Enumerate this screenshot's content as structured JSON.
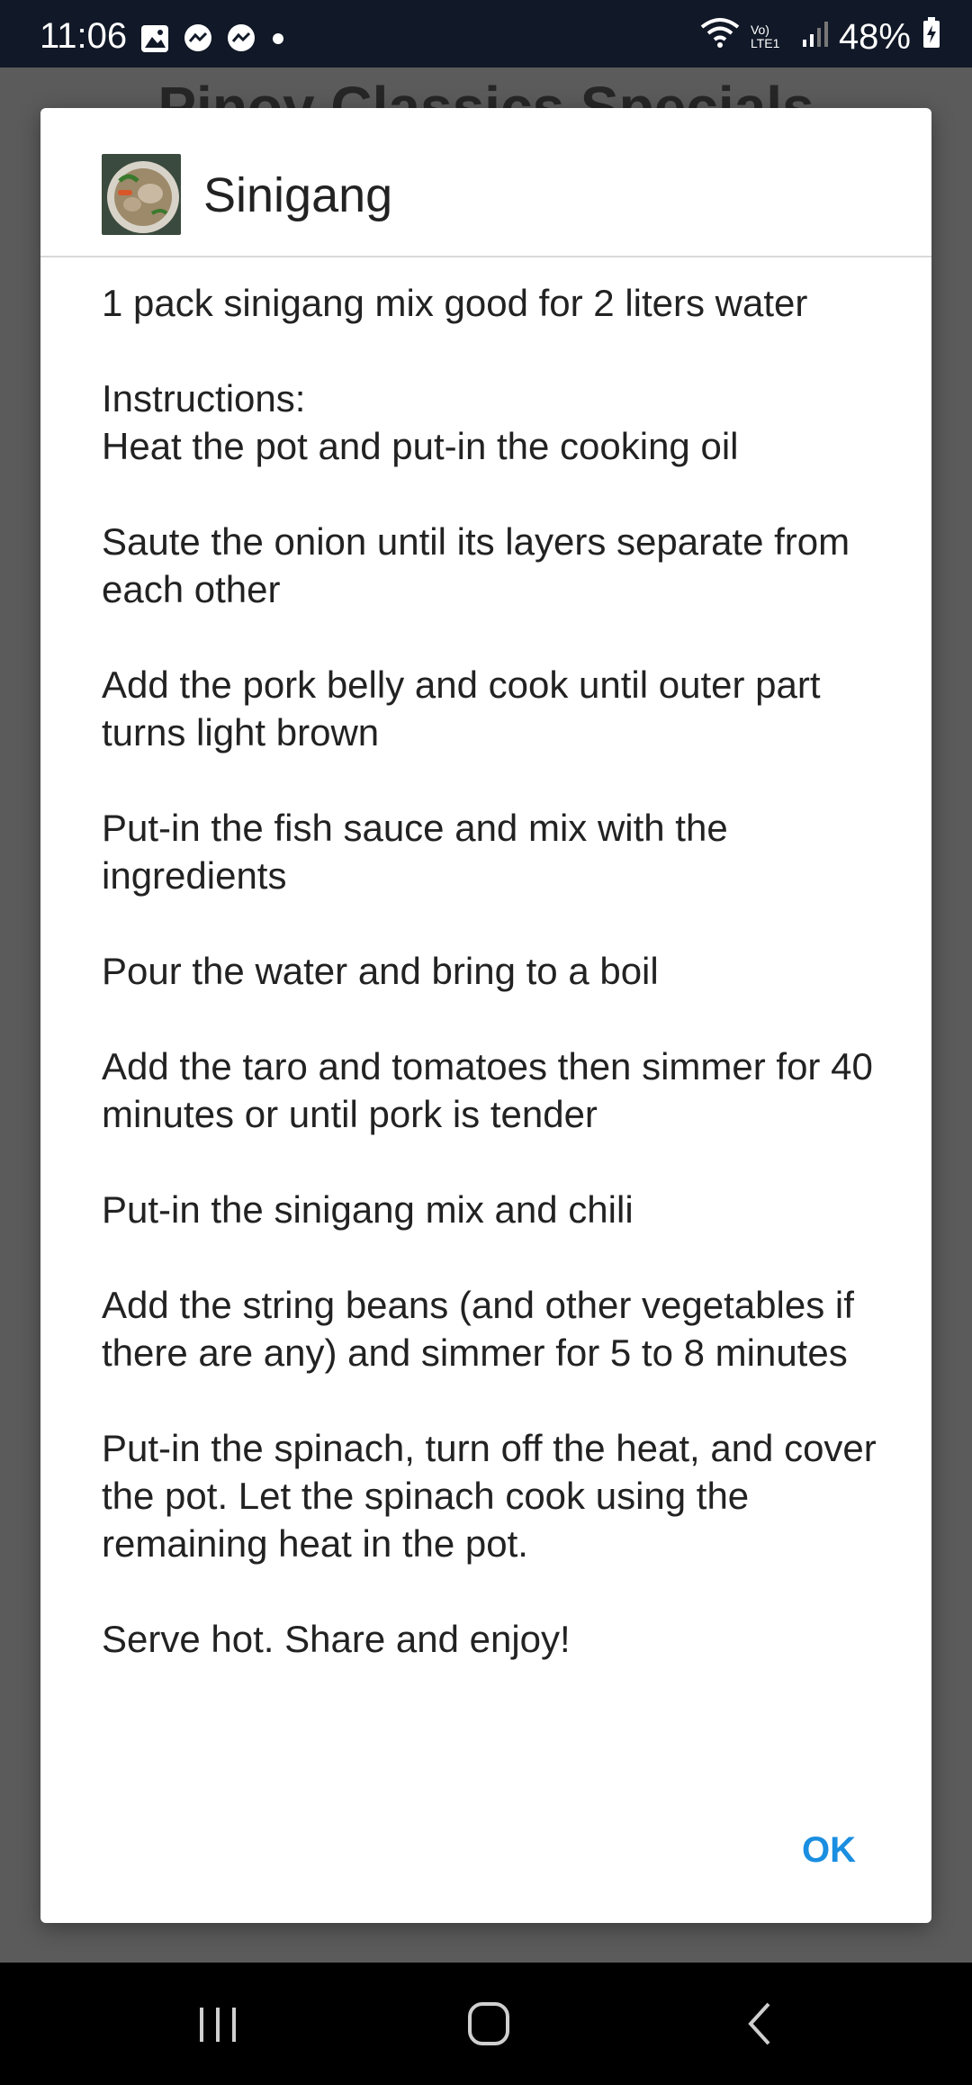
{
  "status_bar": {
    "time": "11:06",
    "battery": "48%",
    "network_label": "Vo) LTE1"
  },
  "background": {
    "title_partial": "Pinoy Classics Specials"
  },
  "dialog": {
    "title": "Sinigang",
    "thumbnail_icon": "food-bowl-image",
    "paragraphs": [
      "1 pack sinigang mix good for 2 liters water",
      "Instructions:\nHeat the pot and put-in the cooking oil",
      "Saute the onion until its layers separate from each other",
      "Add the pork belly and cook until outer part turns light brown",
      "Put-in the fish sauce and mix with the ingredients",
      "Pour the water and bring to a boil",
      "Add the taro and tomatoes then simmer for 40 minutes or until pork is tender",
      "Put-in the sinigang mix and chili",
      "Add the string beans (and other vegetables if there are any) and simmer for 5 to 8 minutes",
      "Put-in the spinach, turn off the heat, and cover the pot. Let the spinach cook using the remaining heat in the pot.",
      "Serve hot. Share and enjoy!"
    ],
    "ok_label": "OK"
  },
  "nav_bar": {
    "recent_icon": "recent-apps-icon",
    "home_icon": "home-icon",
    "back_icon": "back-icon"
  },
  "colors": {
    "status_bg": "#111827",
    "scrim": "#5b5b5b",
    "accent": "#1a8ee0",
    "nav_bg": "#000000"
  }
}
